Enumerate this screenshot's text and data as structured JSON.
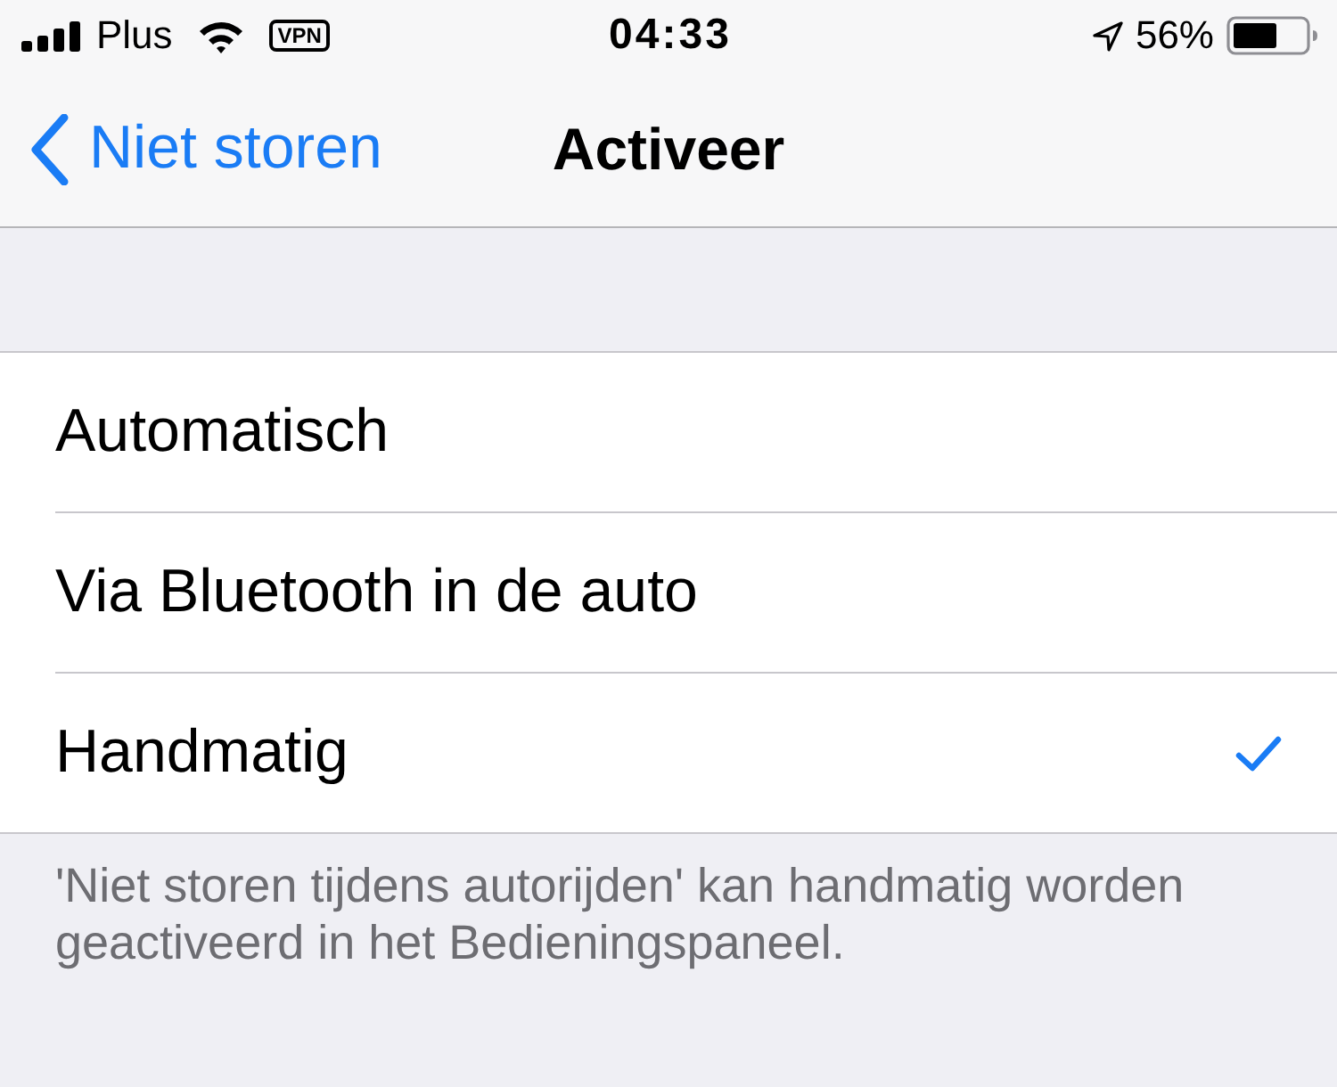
{
  "status_bar": {
    "carrier": "Plus",
    "vpn": "VPN",
    "time": "04:33",
    "battery": "56%"
  },
  "nav_bar": {
    "back": "Niet storen",
    "title": "Activeer"
  },
  "options": [
    {
      "label": "Automatisch",
      "selected": false
    },
    {
      "label": "Via Bluetooth in de auto",
      "selected": false
    },
    {
      "label": "Handmatig",
      "selected": true
    }
  ],
  "footer": "'Niet storen tijdens autorijden' kan handmatig worden geactiveerd in het Bedieningspaneel."
}
